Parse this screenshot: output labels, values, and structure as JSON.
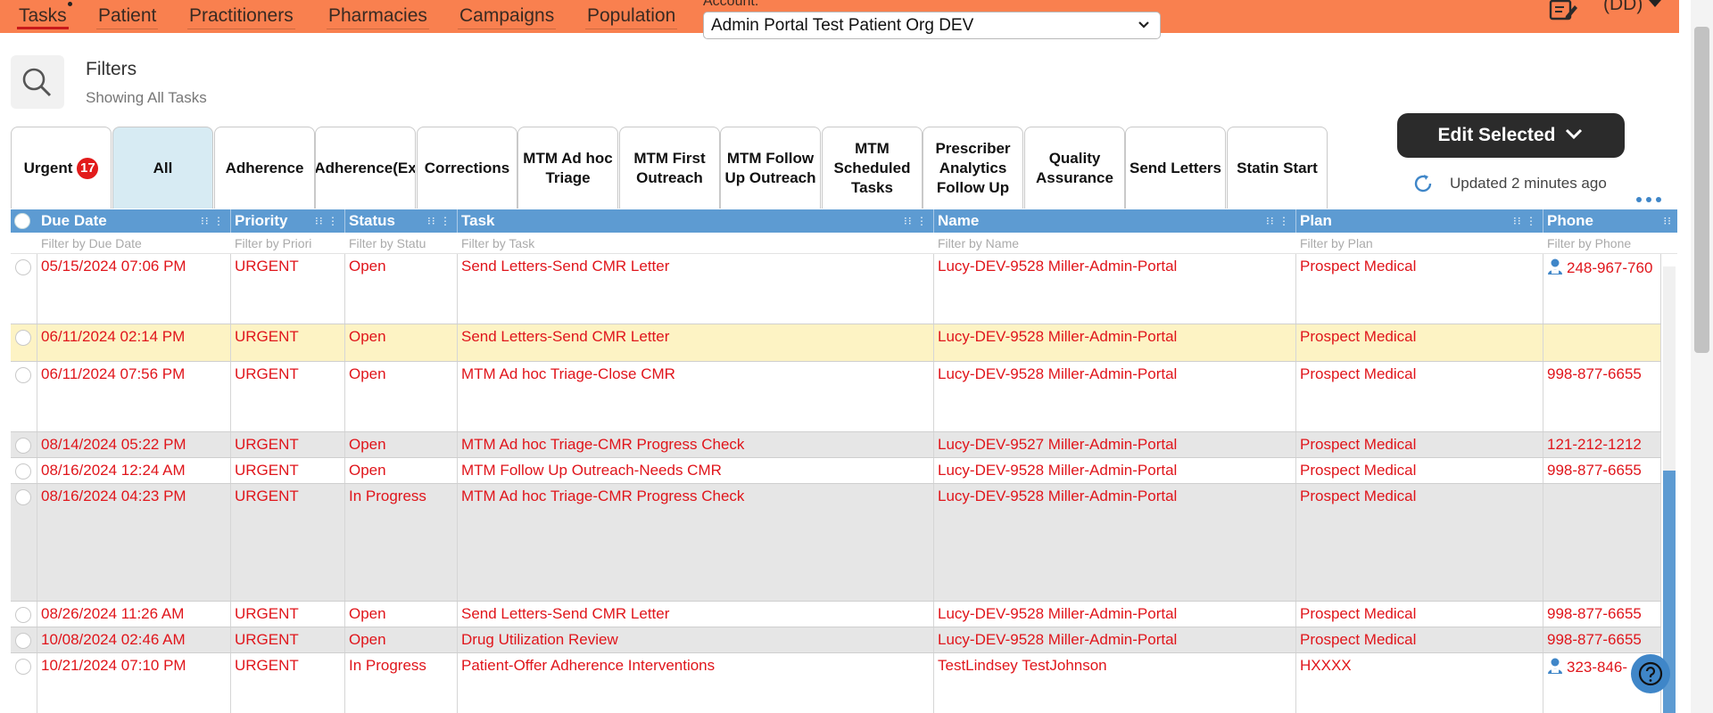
{
  "nav": {
    "items": [
      "Tasks",
      "Patient",
      "Practitioners",
      "Pharmacies",
      "Campaigns",
      "Population"
    ],
    "account_label": "Account:",
    "account_value": "Admin Portal Test Patient Org DEV",
    "user_initials": "(DD)"
  },
  "filters": {
    "title": "Filters",
    "subtitle": "Showing All Tasks"
  },
  "tabs": [
    {
      "label": "Urgent",
      "badge": "17"
    },
    {
      "label": "All",
      "active": true
    },
    {
      "label": "Adherence"
    },
    {
      "label": "Adherence(Ex"
    },
    {
      "label": "Corrections"
    },
    {
      "label": "MTM Ad hoc\nTriage"
    },
    {
      "label": "MTM First\nOutreach"
    },
    {
      "label": "MTM Follow\nUp Outreach"
    },
    {
      "label": "MTM\nScheduled\nTasks"
    },
    {
      "label": "Prescriber\nAnalytics\nFollow Up"
    },
    {
      "label": "Quality\nAssurance"
    },
    {
      "label": "Send Letters"
    },
    {
      "label": "Statin Start"
    }
  ],
  "toolbar": {
    "edit_selected": "Edit Selected",
    "updated": "Updated 2 minutes ago"
  },
  "grid": {
    "columns": [
      "Due Date",
      "Priority",
      "Status",
      "Task",
      "Name",
      "Plan",
      "Phone"
    ],
    "filters": [
      "Filter by Due Date",
      "Filter by Priori",
      "Filter by Statu",
      "Filter by Task",
      "Filter by Name",
      "Filter by Plan",
      "Filter by Phone"
    ],
    "rows": [
      {
        "due": "05/15/2024 07:06 PM",
        "priority": "URGENT",
        "status": "Open",
        "task": "Send Letters-Send CMR Letter",
        "name": "Lucy-DEV-9528 Miller-Admin-Portal",
        "plan": "Prospect Medical",
        "phone": "248-967-760",
        "phone_icon": true
      },
      {
        "due": "06/11/2024 02:14 PM",
        "priority": "URGENT",
        "status": "Open",
        "task": "Send Letters-Send CMR Letter",
        "name": "Lucy-DEV-9528 Miller-Admin-Portal",
        "plan": "Prospect Medical",
        "phone": ""
      },
      {
        "due": "06/11/2024 07:56 PM",
        "priority": "URGENT",
        "status": "Open",
        "task": "MTM Ad hoc Triage-Close CMR",
        "name": "Lucy-DEV-9528 Miller-Admin-Portal",
        "plan": "Prospect Medical",
        "phone": "998-877-6655"
      },
      {
        "due": "08/14/2024 05:22 PM",
        "priority": "URGENT",
        "status": "Open",
        "task": "MTM Ad hoc Triage-CMR Progress Check",
        "name": "Lucy-DEV-9527 Miller-Admin-Portal",
        "plan": "Prospect Medical",
        "phone": "121-212-1212"
      },
      {
        "due": "08/16/2024 12:24 AM",
        "priority": "URGENT",
        "status": "Open",
        "task": "MTM Follow Up Outreach-Needs CMR",
        "name": "Lucy-DEV-9528 Miller-Admin-Portal",
        "plan": "Prospect Medical",
        "phone": "998-877-6655"
      },
      {
        "due": "08/16/2024 04:23 PM",
        "priority": "URGENT",
        "status": "In Progress",
        "task": "MTM Ad hoc Triage-CMR Progress Check",
        "name": "Lucy-DEV-9528 Miller-Admin-Portal",
        "plan": "Prospect Medical",
        "phone": ""
      },
      {
        "due": "08/26/2024 11:26 AM",
        "priority": "URGENT",
        "status": "Open",
        "task": "Send Letters-Send CMR Letter",
        "name": "Lucy-DEV-9528 Miller-Admin-Portal",
        "plan": "Prospect Medical",
        "phone": "998-877-6655"
      },
      {
        "due": "10/08/2024 02:46 AM",
        "priority": "URGENT",
        "status": "Open",
        "task": "Drug Utilization Review",
        "name": "Lucy-DEV-9528 Miller-Admin-Portal",
        "plan": "Prospect Medical",
        "phone": "998-877-6655"
      },
      {
        "due": "10/21/2024 07:10 PM",
        "priority": "URGENT",
        "status": "In Progress",
        "task": "Patient-Offer Adherence Interventions",
        "name": "TestLindsey TestJohnson",
        "plan": "HXXXX",
        "phone": "323-846-",
        "phone_icon": true
      }
    ]
  },
  "colors": {
    "topbar": "#f9804f",
    "header": "#5d9bd2",
    "urgent_text": "#e0151b",
    "row_highlight": "#fdf3c4",
    "row_alt": "#e6e6e6"
  }
}
